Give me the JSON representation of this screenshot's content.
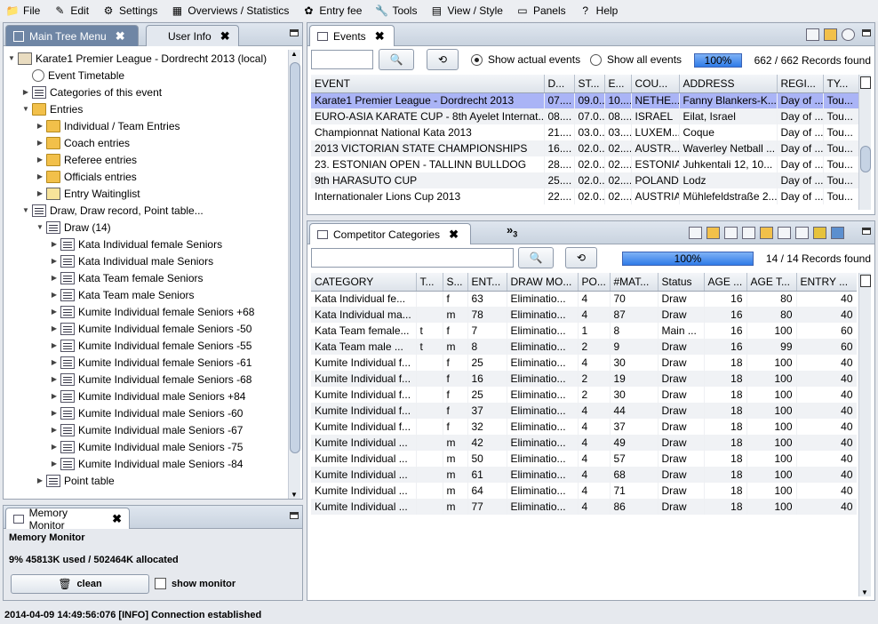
{
  "menubar": {
    "items": [
      {
        "label": "File",
        "icon": "folder-icon"
      },
      {
        "label": "Edit",
        "icon": "edit-icon"
      },
      {
        "label": "Settings",
        "icon": "gear-icon"
      },
      {
        "label": "Overviews / Statistics",
        "icon": "stats-icon"
      },
      {
        "label": "Entry fee",
        "icon": "money-icon"
      },
      {
        "label": "Tools",
        "icon": "wrench-icon"
      },
      {
        "label": "View / Style",
        "icon": "view-icon"
      },
      {
        "label": "Panels",
        "icon": "panels-icon"
      },
      {
        "label": "Help",
        "icon": "help-icon"
      }
    ]
  },
  "tree_panel": {
    "tabs": [
      {
        "label": "Main Tree Menu",
        "close": "✖"
      },
      {
        "label": "User Info",
        "close": "✖"
      }
    ],
    "items": [
      {
        "label": "Karate1 Premier League - Dordrecht 2013 (local)",
        "arrow": "▼",
        "icon": "house"
      },
      {
        "label": "Event Timetable",
        "arrow": "",
        "icon": "clock"
      },
      {
        "label": "Categories of this event",
        "arrow": "▶",
        "icon": "list"
      },
      {
        "label": "Entries",
        "arrow": "▼",
        "icon": "folder"
      },
      {
        "label": "Individual / Team Entries",
        "arrow": "▶",
        "icon": "folder"
      },
      {
        "label": "Coach entries",
        "arrow": "▶",
        "icon": "folder"
      },
      {
        "label": "Referee entries",
        "arrow": "▶",
        "icon": "folder"
      },
      {
        "label": "Officials entries",
        "arrow": "▶",
        "icon": "folder"
      },
      {
        "label": "Entry Waitinglist",
        "arrow": "▶",
        "icon": "doc"
      },
      {
        "label": "Draw, Draw record, Point table...",
        "arrow": "▼",
        "icon": "list"
      },
      {
        "label": "Draw (14)",
        "arrow": "▼",
        "icon": "list"
      },
      {
        "label": "Kata Individual female Seniors",
        "arrow": "▶",
        "icon": "list"
      },
      {
        "label": "Kata Individual male Seniors",
        "arrow": "▶",
        "icon": "list"
      },
      {
        "label": "Kata Team female Seniors",
        "arrow": "▶",
        "icon": "list"
      },
      {
        "label": "Kata Team male Seniors",
        "arrow": "▶",
        "icon": "list"
      },
      {
        "label": "Kumite Individual female Seniors +68",
        "arrow": "▶",
        "icon": "list"
      },
      {
        "label": "Kumite Individual female Seniors -50",
        "arrow": "▶",
        "icon": "list"
      },
      {
        "label": "Kumite Individual female Seniors -55",
        "arrow": "▶",
        "icon": "list"
      },
      {
        "label": "Kumite Individual female Seniors -61",
        "arrow": "▶",
        "icon": "list"
      },
      {
        "label": "Kumite Individual female Seniors -68",
        "arrow": "▶",
        "icon": "list"
      },
      {
        "label": "Kumite Individual male Seniors +84",
        "arrow": "▶",
        "icon": "list"
      },
      {
        "label": "Kumite Individual male Seniors -60",
        "arrow": "▶",
        "icon": "list"
      },
      {
        "label": "Kumite Individual male Seniors -67",
        "arrow": "▶",
        "icon": "list"
      },
      {
        "label": "Kumite Individual male Seniors -75",
        "arrow": "▶",
        "icon": "list"
      },
      {
        "label": "Kumite Individual male Seniors -84",
        "arrow": "▶",
        "icon": "list"
      },
      {
        "label": "Point table",
        "arrow": "▶",
        "icon": "listnum"
      }
    ]
  },
  "memory": {
    "tab": "Memory Monitor",
    "close": "✖",
    "heading": "Memory Monitor",
    "usage": "9%  45813K used / 502464K allocated",
    "clean_label": "clean",
    "show_monitor_label": "show monitor"
  },
  "events": {
    "tab": "Events",
    "close": "✖",
    "search_value": "",
    "radio_actual": "Show actual events",
    "radio_all": "Show all events",
    "progress_label": "100%",
    "progress_fraction": 1.0,
    "records": "662 / 662 Records found",
    "columns": [
      "EVENT",
      "D...",
      "ST...",
      "E...",
      "COU...",
      "ADDRESS",
      "REGI...",
      "TY..."
    ],
    "rows": [
      [
        "Karate1 Premier League - Dordrecht 2013",
        "07....",
        "09.0...",
        "10....",
        "NETHE...",
        "Fanny Blankers-K...",
        "Day of ...",
        "Tou..."
      ],
      [
        "EURO-ASIA KARATE CUP - 8th Ayelet Internat...",
        "08....",
        "07.0...",
        "08....",
        "ISRAEL",
        "Eilat, Israel",
        "Day of ...",
        "Tou..."
      ],
      [
        "Championnat National Kata 2013",
        "21....",
        "03.0...",
        "03....",
        "LUXEM...",
        "Coque",
        "Day of ...",
        "Tou..."
      ],
      [
        "2013 VICTORIAN STATE CHAMPIONSHIPS",
        "16....",
        "02.0...",
        "02....",
        "AUSTR...",
        "Waverley Netball ...",
        "Day of ...",
        "Tou..."
      ],
      [
        "23. ESTONIAN OPEN - TALLINN BULLDOG",
        "28....",
        "02.0...",
        "02....",
        "ESTONIA",
        "Juhkentali 12, 10...",
        "Day of ...",
        "Tou..."
      ],
      [
        "9th HARASUTO CUP",
        "25....",
        "02.0...",
        "02....",
        "POLAND",
        "Lodz",
        "Day of ...",
        "Tou..."
      ],
      [
        "Internationaler Lions Cup 2013",
        "22....",
        "02.0...",
        "02....",
        "AUSTRIA",
        "Mühlefeldstraße 2...",
        "Day of ...",
        "Tou..."
      ]
    ]
  },
  "categories": {
    "tab": "Competitor Categories",
    "close": "✖",
    "overflow": "»",
    "overflow_count": "3",
    "search_value": "",
    "progress_label": "100%",
    "progress_fraction": 1.0,
    "records": "14 / 14 Records found",
    "columns": [
      "CATEGORY",
      "T...",
      "S...",
      "ENT...",
      "DRAW MO...",
      "PO...",
      "#MAT...",
      "Status",
      "AGE ...",
      "AGE T...",
      "ENTRY ..."
    ],
    "rows": [
      [
        "Kata Individual fe...",
        "",
        "f",
        "63",
        "Eliminatio...",
        "4",
        "70",
        "Draw",
        "16",
        "80",
        "40"
      ],
      [
        "Kata Individual ma...",
        "",
        "m",
        "78",
        "Eliminatio...",
        "4",
        "87",
        "Draw",
        "16",
        "80",
        "40"
      ],
      [
        "Kata Team female...",
        "t",
        "f",
        "7",
        "Eliminatio...",
        "1",
        "8",
        "Main ...",
        "16",
        "100",
        "60"
      ],
      [
        "Kata Team male ...",
        "t",
        "m",
        "8",
        "Eliminatio...",
        "2",
        "9",
        "Draw",
        "16",
        "99",
        "60"
      ],
      [
        "Kumite Individual f...",
        "",
        "f",
        "25",
        "Eliminatio...",
        "4",
        "30",
        "Draw",
        "18",
        "100",
        "40"
      ],
      [
        "Kumite Individual f...",
        "",
        "f",
        "16",
        "Eliminatio...",
        "2",
        "19",
        "Draw",
        "18",
        "100",
        "40"
      ],
      [
        "Kumite Individual f...",
        "",
        "f",
        "25",
        "Eliminatio...",
        "2",
        "30",
        "Draw",
        "18",
        "100",
        "40"
      ],
      [
        "Kumite Individual f...",
        "",
        "f",
        "37",
        "Eliminatio...",
        "4",
        "44",
        "Draw",
        "18",
        "100",
        "40"
      ],
      [
        "Kumite Individual f...",
        "",
        "f",
        "32",
        "Eliminatio...",
        "4",
        "37",
        "Draw",
        "18",
        "100",
        "40"
      ],
      [
        "Kumite Individual ...",
        "",
        "m",
        "42",
        "Eliminatio...",
        "4",
        "49",
        "Draw",
        "18",
        "100",
        "40"
      ],
      [
        "Kumite Individual ...",
        "",
        "m",
        "50",
        "Eliminatio...",
        "4",
        "57",
        "Draw",
        "18",
        "100",
        "40"
      ],
      [
        "Kumite Individual ...",
        "",
        "m",
        "61",
        "Eliminatio...",
        "4",
        "68",
        "Draw",
        "18",
        "100",
        "40"
      ],
      [
        "Kumite Individual ...",
        "",
        "m",
        "64",
        "Eliminatio...",
        "4",
        "71",
        "Draw",
        "18",
        "100",
        "40"
      ],
      [
        "Kumite Individual ...",
        "",
        "m",
        "77",
        "Eliminatio...",
        "4",
        "86",
        "Draw",
        "18",
        "100",
        "40"
      ]
    ]
  },
  "statusbar": {
    "text": "2014-04-09 14:49:56:076 [INFO] Connection established"
  },
  "colors": {
    "active_tab": "#6f86a5",
    "selected_row": "#aab4f6",
    "progress": "#2f7be8"
  }
}
